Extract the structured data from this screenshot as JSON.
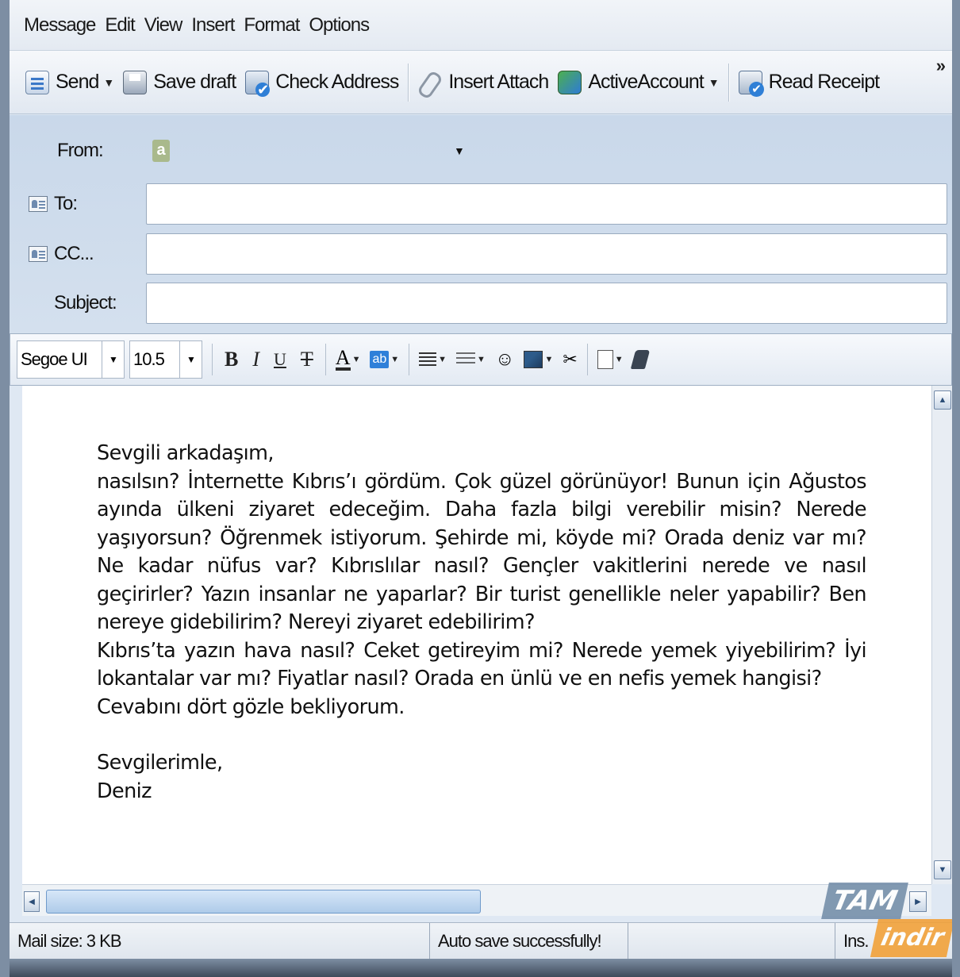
{
  "menu": {
    "items": [
      "Message",
      "Edit",
      "View",
      "Insert",
      "Format",
      "Options"
    ]
  },
  "toolbar": {
    "send_label": "Send",
    "save_draft_label": "Save draft",
    "check_address_label": "Check Address",
    "insert_attach_label": "Insert Attach",
    "active_account_label": "ActiveAccount",
    "read_receipt_label": "Read Receipt",
    "more_glyph": "»"
  },
  "header": {
    "from_label": "From:",
    "from_logo": "a",
    "to_label": "To:",
    "cc_label": "CC...",
    "subject_label": "Subject:",
    "to_value": "",
    "cc_value": "",
    "subject_value": ""
  },
  "format": {
    "font_name": "Segoe UI",
    "font_size": "10.5",
    "bold": "B",
    "italic": "I",
    "underline": "U",
    "strike": "T",
    "color_a": "A",
    "highlight": "ab"
  },
  "body": {
    "greeting": "Sevgili arkadaşım,",
    "paragraph1": "nasılsın? İnternette Kıbrıs’ı gördüm. Çok güzel görünüyor! Bunun için Ağustos ayında ülkeni ziyaret edeceğim. Daha fazla bilgi verebilir misin? Nerede yaşıyorsun? Öğrenmek istiyorum. Şehirde mi, köyde mi? Orada deniz var mı? Ne kadar nüfus var? Kıbrıslılar nasıl? Gençler vakitlerini nerede ve nasıl geçirirler? Yazın insanlar ne yaparlar? Bir turist genellikle neler yapabilir? Ben nereye gidebilirim? Nereyi ziyaret edebilirim?",
    "paragraph2": "Kıbrıs’ta yazın hava nasıl? Ceket getireyim mi? Nerede yemek yiyebilirim? İyi lokantalar var mı? Fiyatlar nasıl? Orada en ünlü ve en nefis yemek hangisi?",
    "closing_line": "Cevabını dört gözle bekliyorum.",
    "signoff": "Sevgilerimle,",
    "signature": "Deniz"
  },
  "status": {
    "mail_size": "Mail size: 3 KB",
    "autosave": "Auto save successfully!",
    "mode": "Ins."
  },
  "watermark": {
    "top": "TAM",
    "bottom": "indir"
  }
}
